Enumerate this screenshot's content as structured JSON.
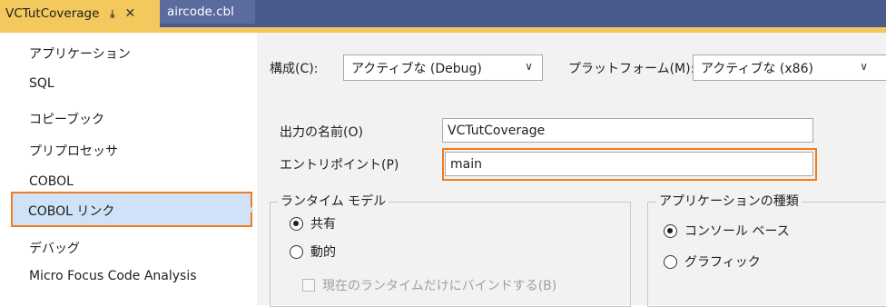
{
  "tabs": [
    {
      "label": "VCTutCoverage",
      "active": true
    },
    {
      "label": "aircode.cbl",
      "active": false
    }
  ],
  "sidebar": {
    "items": [
      {
        "label": "アプリケーション"
      },
      {
        "label": "SQL"
      },
      {
        "label": "コピーブック"
      },
      {
        "label": "プリプロセッサ"
      },
      {
        "label": "COBOL"
      },
      {
        "label": "COBOL リンク",
        "selected": true
      },
      {
        "label": "デバッグ"
      },
      {
        "label": "Micro Focus Code Analysis"
      }
    ]
  },
  "config": {
    "config_label": "構成(C):",
    "config_value": "アクティブな (Debug)",
    "platform_label": "プラットフォーム(M):",
    "platform_value": "アクティブな (x86)"
  },
  "form": {
    "output_label": "出力の名前(O)",
    "output_value": "VCTutCoverage",
    "entry_label": "エントリポイント(P)",
    "entry_value": "main"
  },
  "runtime_group": {
    "title": "ランタイム モデル",
    "shared_label": "共有",
    "dynamic_label": "動的",
    "bind_label": "現在のランタイムだけにバインドする(B)"
  },
  "app_type_group": {
    "title": "アプリケーションの種類",
    "console_label": "コンソール ベース",
    "graphic_label": "グラフィック"
  },
  "colors": {
    "highlight": "#f07d1e",
    "tab_active": "#f3c85c",
    "tabbar": "#4a5a8c",
    "selection": "#cfe2f7"
  }
}
